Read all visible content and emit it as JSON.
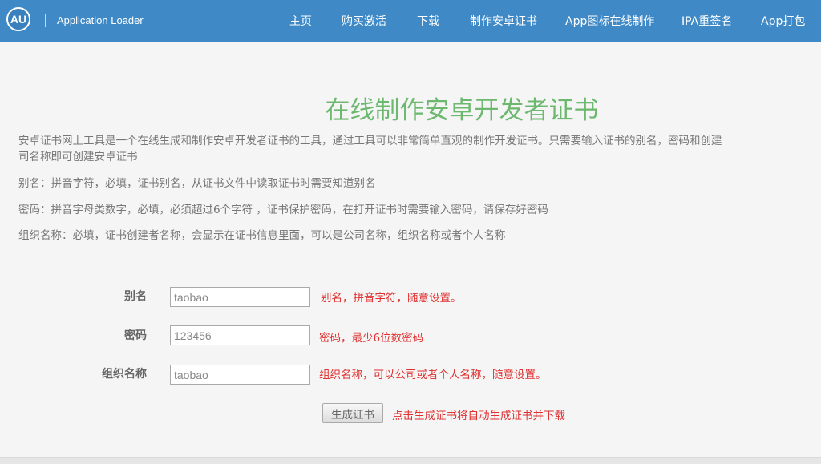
{
  "header": {
    "logo_text": "AU",
    "app_name": "Application Loader",
    "nav": [
      "主页",
      "购买激活",
      "下载",
      "制作安卓证书",
      "App图标在线制作",
      "IPA重签名",
      "App打包"
    ]
  },
  "main": {
    "title": "在线制作安卓开发者证书",
    "description_lines": [
      "安卓证书网上工具是一个在线生成和制作安卓开发者证书的工具，通过工具可以非常简单直观的制作开发证书。只需要输入证书的别名，密码和创建",
      "司名称即可创建安卓证书",
      "别名：拼音字符，必填，证书别名，从证书文件中读取证书时需要知道别名",
      "密码：拼音字母类数字，必填，必须超过6个字符 ，证书保护密码，在打开证书时需要输入密码，请保存好密码",
      "组织名称：必填，证书创建者名称，会显示在证书信息里面，可以是公司名称，组织名称或者个人名称"
    ]
  },
  "form": {
    "alias": {
      "label": "别名",
      "value": "taobao",
      "hint": "别名，拼音字符，随意设置。"
    },
    "password": {
      "label": "密码",
      "value": "123456",
      "hint": "密码，最少6位数密码"
    },
    "org": {
      "label": "组织名称",
      "value": "taobao",
      "hint": "组织名称，可以公司或者个人名称，随意设置。"
    },
    "submit_label": "生成证书",
    "submit_hint": "点击生成证书将自动生成证书并下载"
  }
}
